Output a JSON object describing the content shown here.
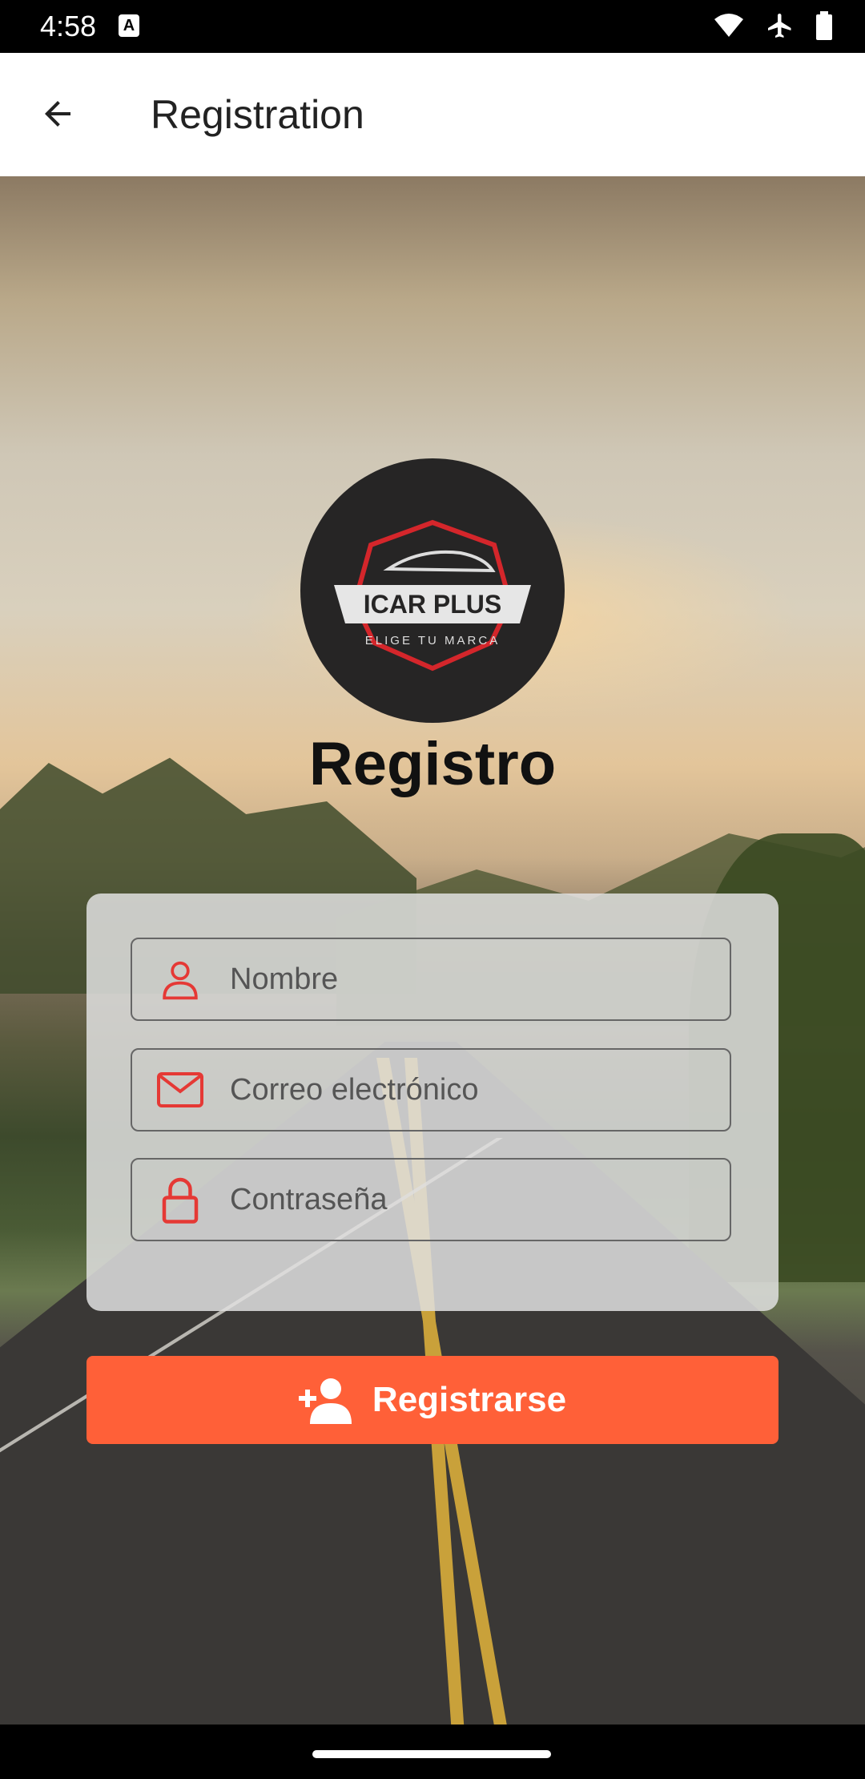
{
  "status_bar": {
    "time": "4:58",
    "notification_badge": "A",
    "icons": [
      "wifi-icon",
      "airplane-icon",
      "battery-icon"
    ]
  },
  "app_bar": {
    "title": "Registration",
    "back_icon": "arrow-back-icon"
  },
  "logo": {
    "brand": "ICAR PLUS",
    "tagline": "ELIGE TU MARCA"
  },
  "heading": "Registro",
  "form": {
    "name_placeholder": "Nombre",
    "email_placeholder": "Correo electrónico",
    "password_placeholder": "Contraseña"
  },
  "register_button": {
    "label": "Registrarse",
    "icon": "add-user-icon"
  },
  "colors": {
    "accent": "#ff6038",
    "icon_red": "#e53935",
    "logo_bg": "#262525"
  }
}
